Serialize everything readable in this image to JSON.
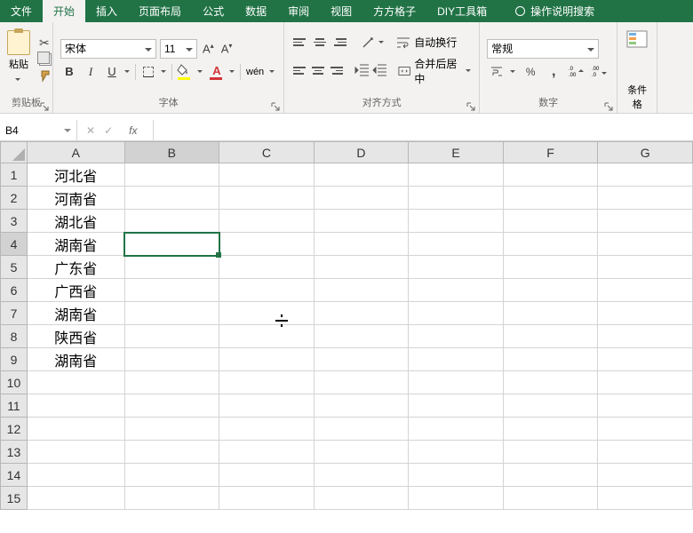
{
  "menu": {
    "items": [
      "文件",
      "开始",
      "插入",
      "页面布局",
      "公式",
      "数据",
      "审阅",
      "视图",
      "方方格子",
      "DIY工具箱"
    ],
    "active_index": 1,
    "tell_me": "操作说明搜索"
  },
  "ribbon": {
    "clipboard": {
      "paste": "粘贴",
      "label": "剪贴板"
    },
    "font": {
      "name": "宋体",
      "size": "11",
      "bold": "B",
      "italic": "I",
      "underline": "U",
      "font_color_letter": "A",
      "wen": "wén",
      "label": "字体"
    },
    "align": {
      "wrap": "自动换行",
      "merge": "合并后居中",
      "label": "对齐方式"
    },
    "number": {
      "format": "常规",
      "percent": "%",
      "comma": ",",
      "inc": ".0 .00",
      "dec": ".00 .0",
      "label": "数字"
    },
    "cond": {
      "label": "条件格"
    }
  },
  "formula_bar": {
    "name_box": "B4",
    "fx": "fx",
    "x": "✕",
    "check": "✓",
    "value": ""
  },
  "grid": {
    "columns": [
      "A",
      "B",
      "C",
      "D",
      "E",
      "F",
      "G"
    ],
    "rows": 15,
    "selected": {
      "row": 4,
      "col": "B"
    },
    "data": {
      "A1": "河北省",
      "A2": "河南省",
      "A3": "湖北省",
      "A4": "湖南省",
      "A5": "广东省",
      "A6": "广西省",
      "A7": "湖南省",
      "A8": "陕西省",
      "A9": "湖南省"
    }
  }
}
